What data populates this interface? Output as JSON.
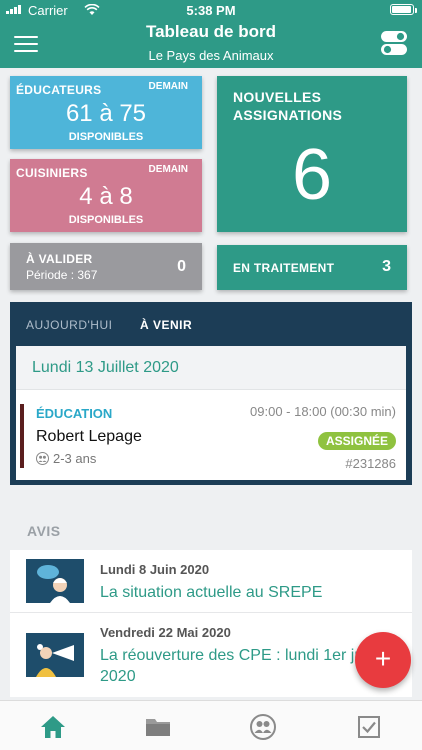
{
  "status_bar": {
    "carrier": "Carrier",
    "time": "5:38 PM"
  },
  "header": {
    "title": "Tableau de bord",
    "subtitle": "Le Pays des Animaux"
  },
  "cards": {
    "educateurs": {
      "label": "ÉDUCATEURS",
      "tag": "DEMAIN",
      "value": "61 à 75",
      "sub": "DISPONIBLES",
      "color": "#4eb5d9"
    },
    "cuisiniers": {
      "label": "CUISINIERS",
      "tag": "DEMAIN",
      "value": "4 à 8",
      "sub": "DISPONIBLES",
      "color": "#d07b92"
    },
    "a_valider": {
      "label": "À VALIDER",
      "period": "Période : 367",
      "count": "0",
      "color": "#9a9a9e"
    },
    "nouvelles": {
      "label_line1": "NOUVELLES",
      "label_line2": "ASSIGNATIONS",
      "count": "6",
      "color": "#2e9a87"
    },
    "en_traitement": {
      "label": "EN TRAITEMENT",
      "count": "3",
      "color": "#2e9a87"
    }
  },
  "agenda": {
    "tabs": [
      "AUJOURD'HUI",
      "À VENIR"
    ],
    "active_tab": "À VENIR",
    "date": "Lundi 13 Juillet 2020",
    "entry": {
      "category": "ÉDUCATION",
      "name": "Robert Lepage",
      "age_group": "2-3 ans",
      "time": "09:00 - 18:00 (00:30 min)",
      "status": "ASSIGNÉE",
      "ref": "#231286"
    }
  },
  "avis": {
    "title": "AVIS",
    "items": [
      {
        "date": "Lundi 8 Juin 2020",
        "title": "La situation actuelle au SREPE"
      },
      {
        "date": "Vendredi 22 Mai 2020",
        "title": "La réouverture des CPE : lundi 1er juin 2020"
      }
    ]
  },
  "fab": {
    "label": "+"
  },
  "bottom_nav": {
    "icons": [
      "home-icon",
      "folder-icon",
      "people-icon",
      "checkbox-icon"
    ],
    "active": "home-icon",
    "active_color": "#2e9a87"
  }
}
